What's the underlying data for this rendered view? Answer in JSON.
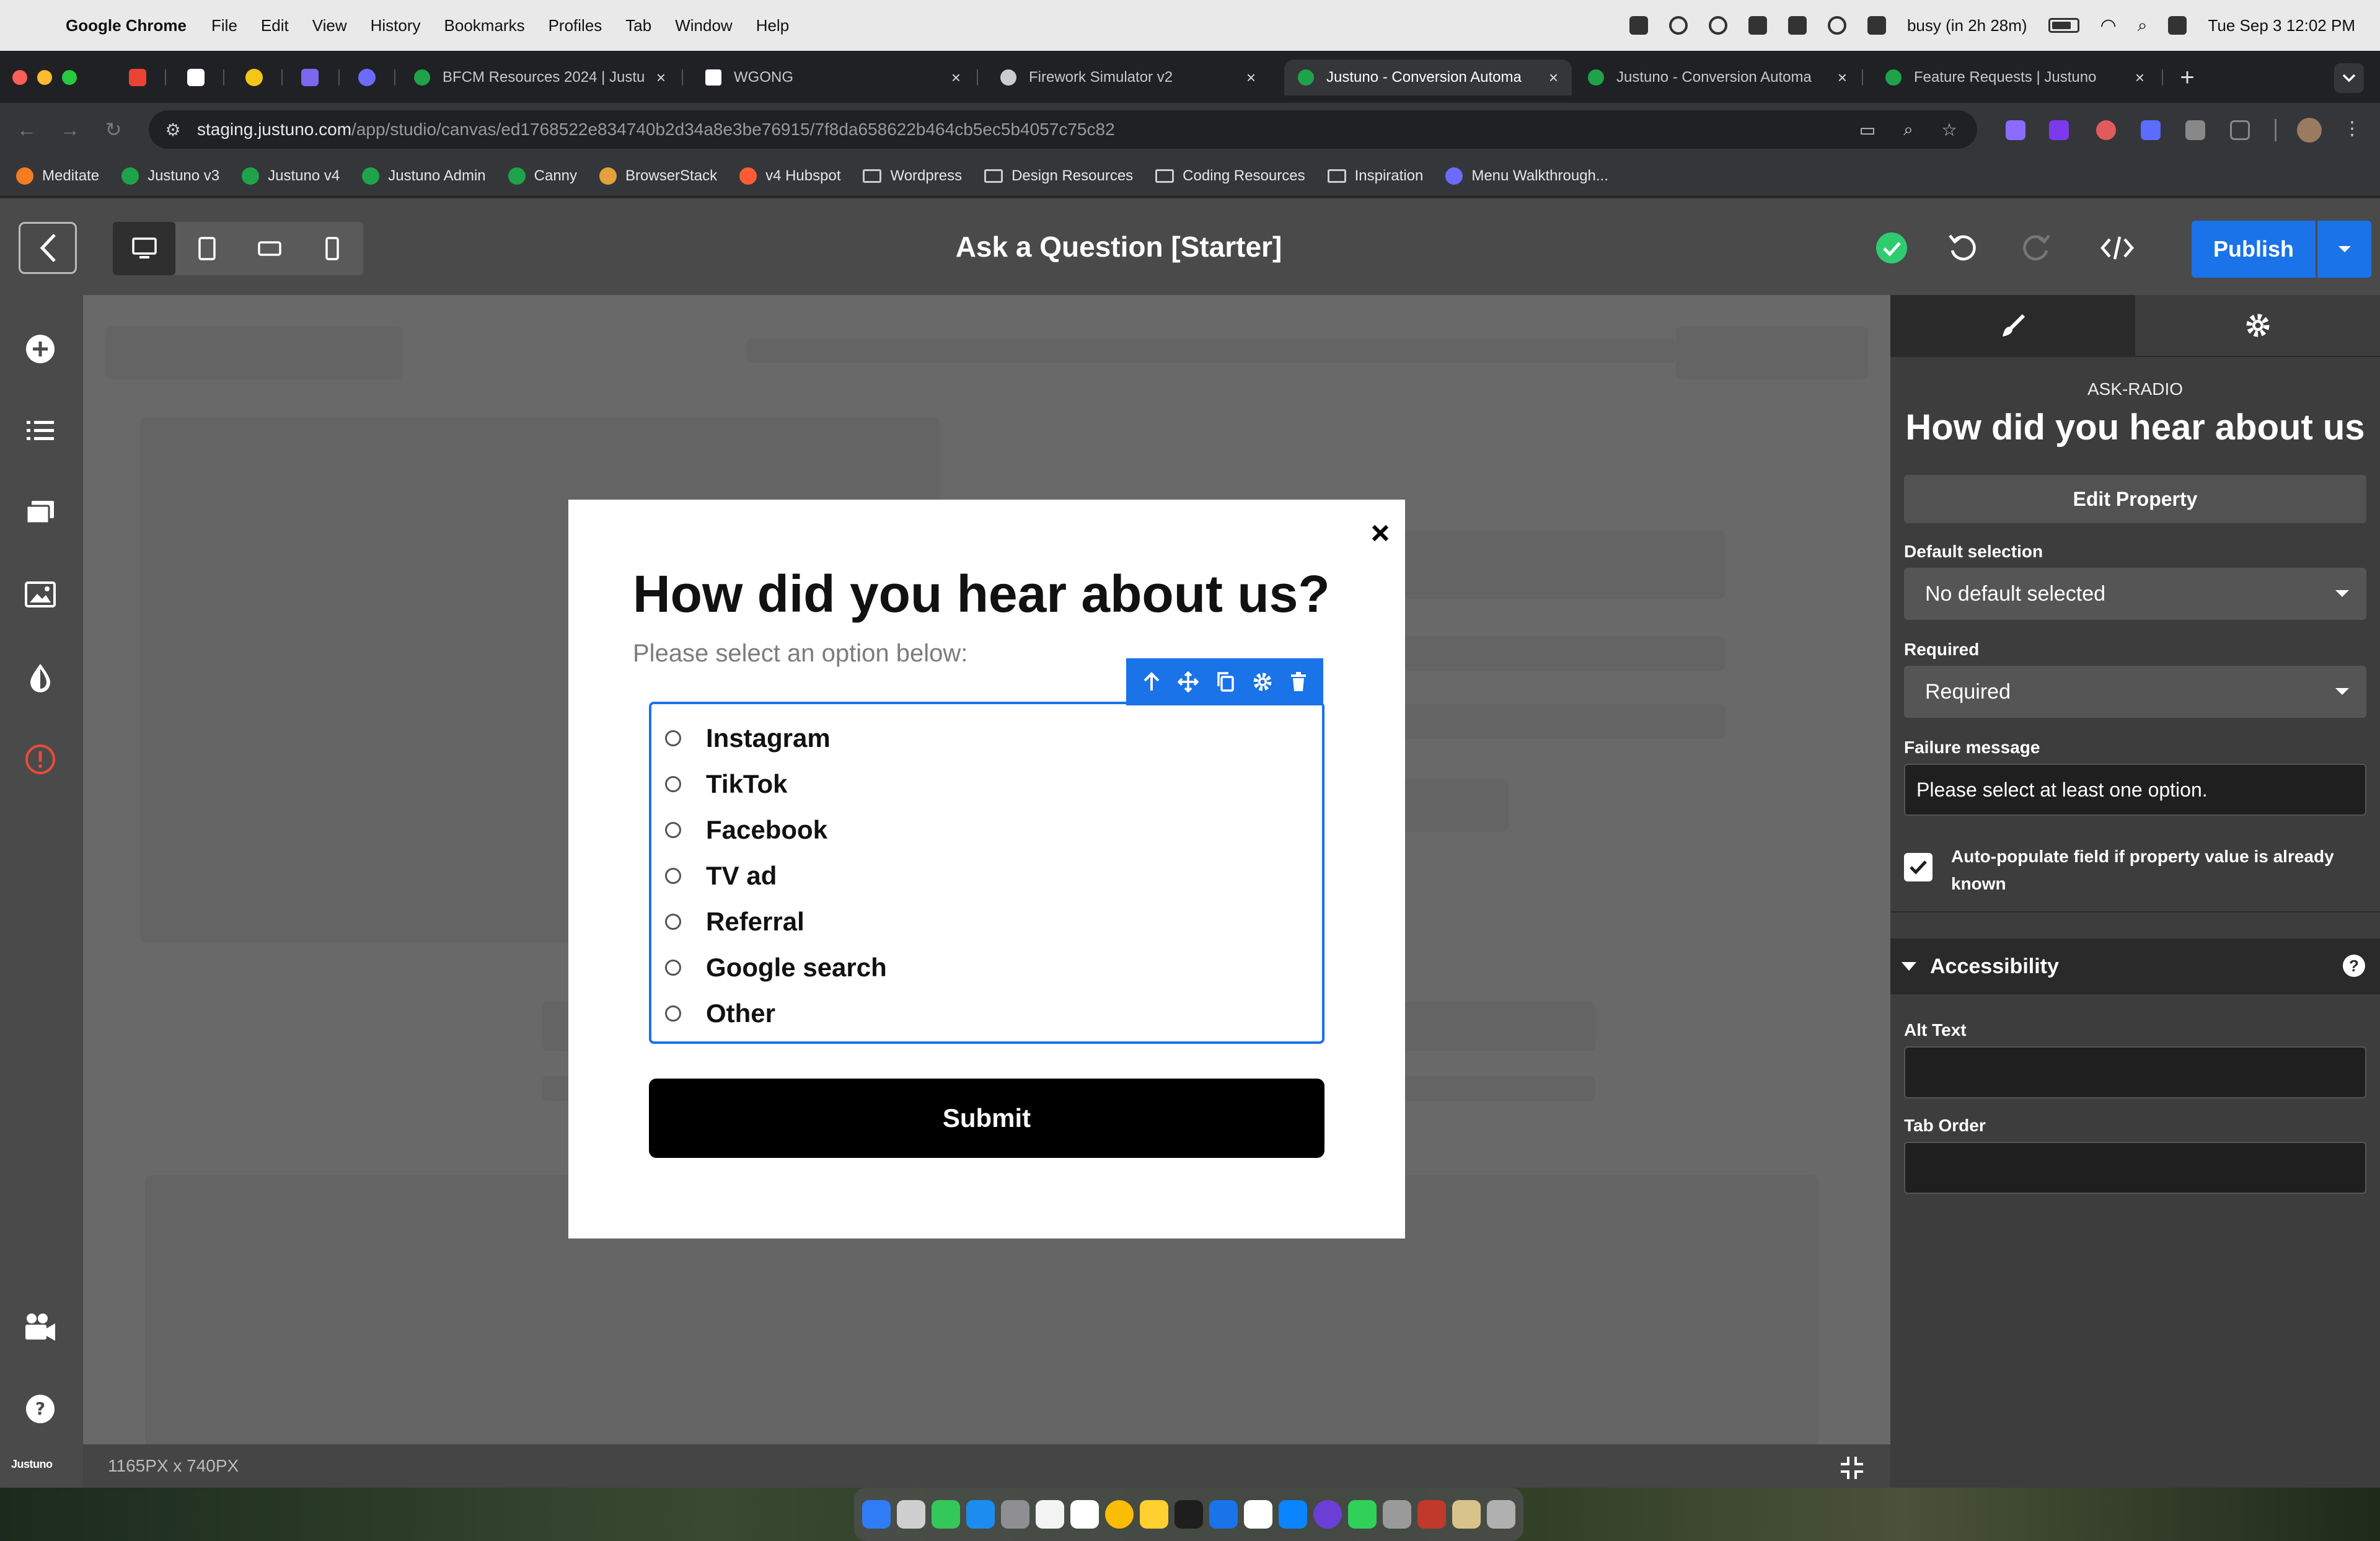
{
  "menubar": {
    "app_name": "Google Chrome",
    "items": [
      "File",
      "Edit",
      "View",
      "History",
      "Bookmarks",
      "Profiles",
      "Tab",
      "Window",
      "Help"
    ],
    "status": "busy (in 2h 28m)",
    "clock": "Tue Sep 3  12:02 PM"
  },
  "tabs": [
    {
      "label": "BFCM Resources 2024 | Justu",
      "close": "×",
      "color": "#1fa34a"
    },
    {
      "label": "WGONG",
      "close": "×",
      "color": "#ffffff"
    },
    {
      "label": "Firework Simulator v2",
      "close": "×",
      "color": "#cccccc"
    },
    {
      "label": "Justuno - Conversion Automa",
      "close": "×",
      "color": "#1fa34a",
      "active": true
    },
    {
      "label": "Justuno - Conversion Automa",
      "close": "×",
      "color": "#1fa34a"
    },
    {
      "label": "Feature Requests | Justuno",
      "close": "×",
      "color": "#1fa34a"
    }
  ],
  "new_tab": "+",
  "omnibox": {
    "host": "staging.justuno.com",
    "path": "/app/studio/canvas/ed1768522e834740b2d34a8e3be76915/7f8da658622b464cb5ec5b4057c75c82"
  },
  "bookmarks": [
    {
      "label": "Meditate",
      "icon": "orange-dot-icon",
      "color": "#f57c1f"
    },
    {
      "label": "Justuno v3",
      "icon": "justuno-icon",
      "color": "#1fa34a"
    },
    {
      "label": "Justuno v4",
      "icon": "justuno-icon",
      "color": "#1fa34a"
    },
    {
      "label": "Justuno Admin",
      "icon": "justuno-icon",
      "color": "#1fa34a"
    },
    {
      "label": "Canny",
      "icon": "justuno-icon",
      "color": "#1fa34a"
    },
    {
      "label": "BrowserStack",
      "icon": "browserstack-icon",
      "color": "#e2a03f"
    },
    {
      "label": "v4 Hubspot",
      "icon": "hubspot-icon",
      "color": "#ff5c35"
    },
    {
      "label": "Wordpress",
      "icon": "folder-icon",
      "color": "#cccccc"
    },
    {
      "label": "Design Resources",
      "icon": "folder-icon",
      "color": "#cccccc"
    },
    {
      "label": "Coding Resources",
      "icon": "folder-icon",
      "color": "#cccccc"
    },
    {
      "label": "Inspiration",
      "icon": "folder-icon",
      "color": "#cccccc"
    },
    {
      "label": "Menu Walkthrough...",
      "icon": "sparkle-icon",
      "color": "#6b6bff"
    }
  ],
  "studio": {
    "title": "Ask a Question [Starter]",
    "publish_label": "Publish",
    "canvas_size": "1165PX x 740PX",
    "brand": "Justuno"
  },
  "modal": {
    "close_glyph": "×",
    "heading": "How did you hear about us?",
    "subheading": "Please select an option below:",
    "options": [
      "Instagram",
      "TikTok",
      "Facebook",
      "TV ad",
      "Referral",
      "Google search",
      "Other"
    ],
    "submit_label": "Submit"
  },
  "panel": {
    "element_type": "ASK-RADIO",
    "element_name": "How did you hear about us",
    "edit_property_label": "Edit Property",
    "default_selection_label": "Default selection",
    "default_selection_value": "No default selected",
    "required_label": "Required",
    "required_value": "Required",
    "failure_message_label": "Failure message",
    "failure_message_value": "Please select at least one option.",
    "autopopulate_label": "Auto-populate field if property value is already known",
    "autopopulate_checked": true,
    "accessibility_label": "Accessibility",
    "alt_text_label": "Alt Text",
    "alt_text_value": "",
    "tab_order_label": "Tab Order",
    "tab_order_value": ""
  },
  "colors": {
    "accent": "#1a73e8",
    "success": "#2ecc71",
    "danger": "#e74c3c"
  }
}
